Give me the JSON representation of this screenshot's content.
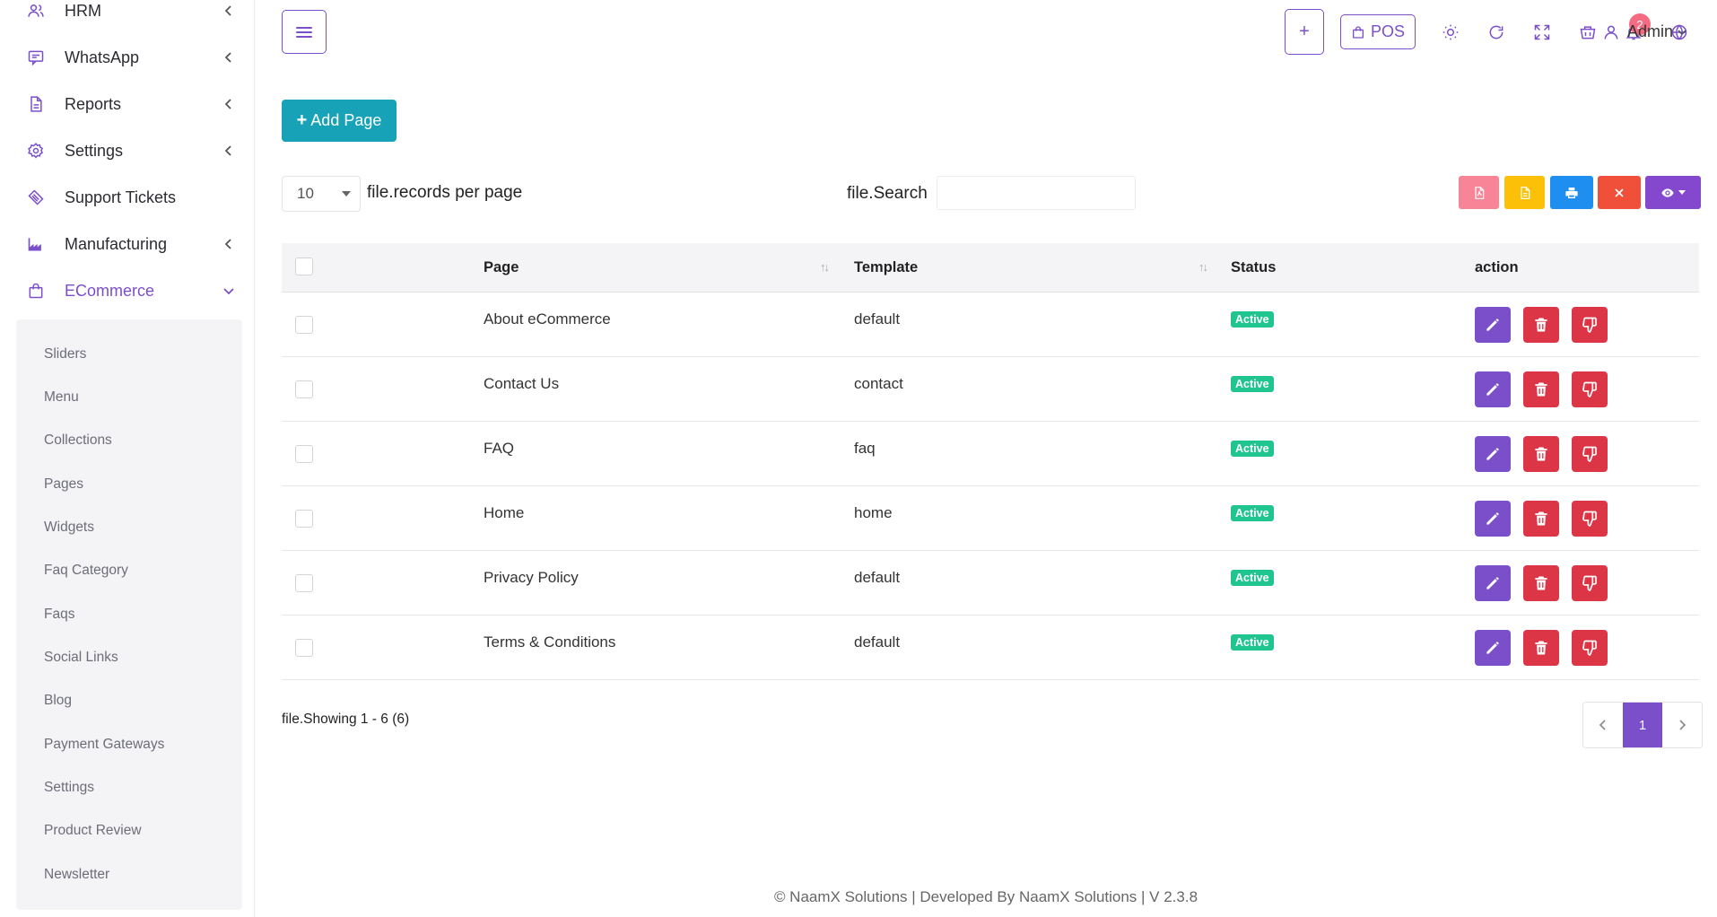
{
  "sidebar": {
    "items": [
      {
        "label": "HRM",
        "icon": "users-icon",
        "has_chevron": true
      },
      {
        "label": "WhatsApp",
        "icon": "chat-icon",
        "has_chevron": true
      },
      {
        "label": "Reports",
        "icon": "file-icon",
        "has_chevron": true
      },
      {
        "label": "Settings",
        "icon": "gear-icon",
        "has_chevron": true
      },
      {
        "label": "Support Tickets",
        "icon": "ticket-icon",
        "has_chevron": false
      },
      {
        "label": "Manufacturing",
        "icon": "factory-icon",
        "has_chevron": true
      },
      {
        "label": "ECommerce",
        "icon": "shopping-bag-icon",
        "has_chevron": true,
        "active": true
      }
    ],
    "ecommerce_submenu": [
      "Sliders",
      "Menu",
      "Collections",
      "Pages",
      "Widgets",
      "Faq Category",
      "Faqs",
      "Social Links",
      "Blog",
      "Payment Gateways",
      "Settings",
      "Product Review",
      "Newsletter"
    ]
  },
  "header": {
    "plus_label": "+",
    "pos_label": "POS",
    "notification_count": "2",
    "user_name": "Admin"
  },
  "toolbar": {
    "add_page_label": "Add Page",
    "per_page_value": "10",
    "per_page_label": "file.records per page",
    "search_label": "file.Search",
    "search_value": ""
  },
  "table": {
    "columns": [
      "Page",
      "Template",
      "Status",
      "action"
    ],
    "rows": [
      {
        "page": "About eCommerce",
        "template": "default",
        "status": "Active"
      },
      {
        "page": "Contact Us",
        "template": "contact",
        "status": "Active"
      },
      {
        "page": "FAQ",
        "template": "faq",
        "status": "Active"
      },
      {
        "page": "Home",
        "template": "home",
        "status": "Active"
      },
      {
        "page": "Privacy Policy",
        "template": "default",
        "status": "Active"
      },
      {
        "page": "Terms & Conditions",
        "template": "default",
        "status": "Active"
      }
    ]
  },
  "pagination": {
    "showing": "file.Showing 1 - 6 (6)",
    "current_page": "1"
  },
  "footer": {
    "text": "© NaamX Solutions | Developed By NaamX Solutions | V 2.3.8"
  },
  "colors": {
    "primary": "#7b4fc9",
    "info": "#17a2b8",
    "danger": "#dc3545",
    "success": "#1fc48e"
  }
}
